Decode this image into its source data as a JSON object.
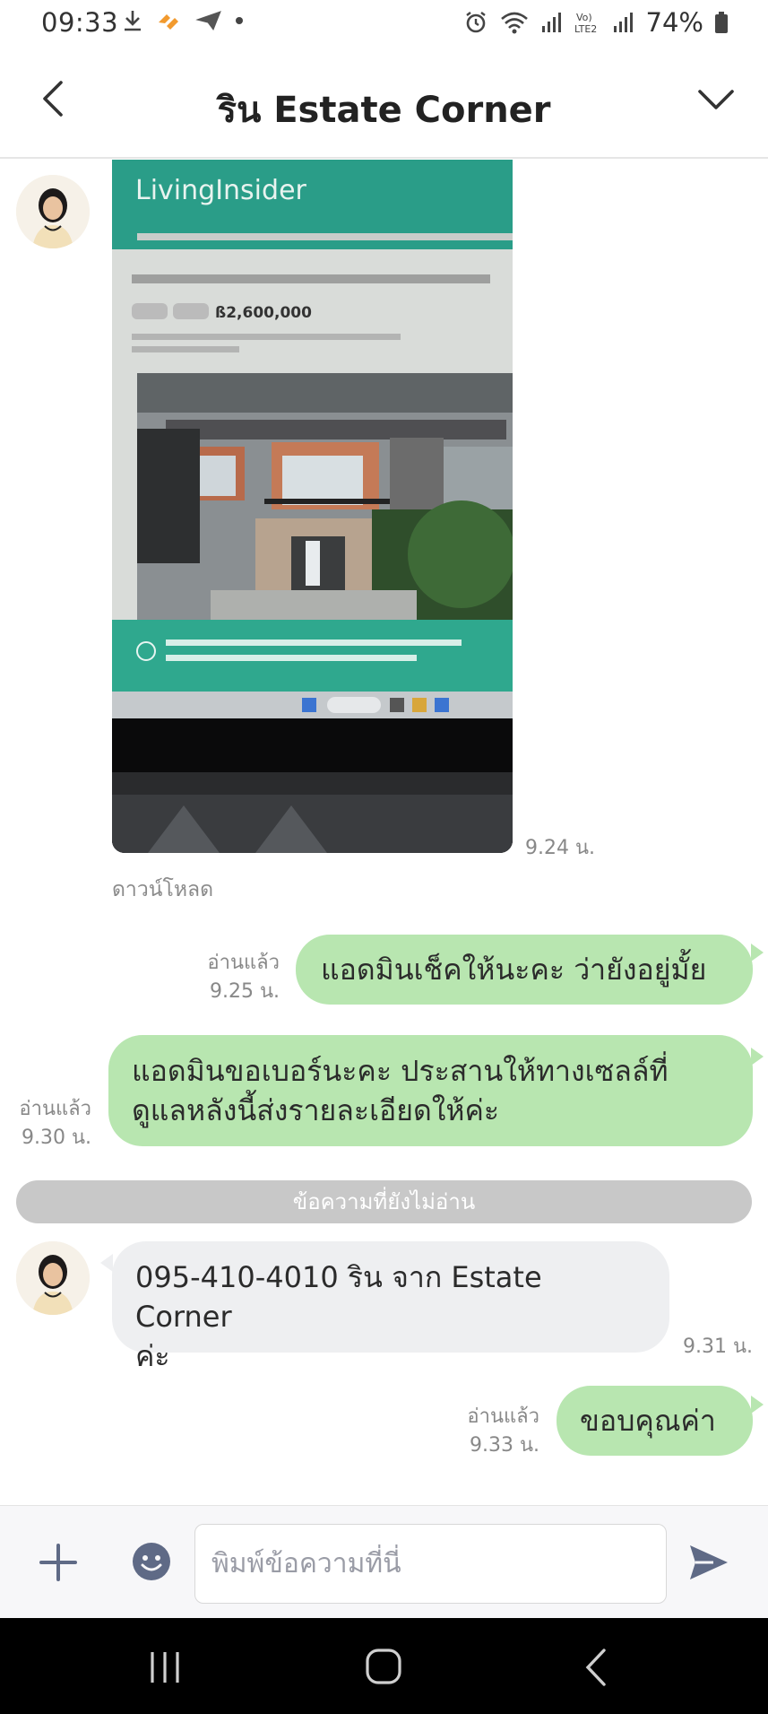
{
  "status_bar": {
    "time": "09:33",
    "battery_percent": "74%",
    "network_label": "VoLTE2"
  },
  "header": {
    "title": "ริน Estate Corner"
  },
  "messages": {
    "image_message": {
      "screenshot_brand": "LivingInsider",
      "screenshot_price": "ß2,600,000",
      "time": "9.24 น.",
      "download_label": "ดาวน์โหลด"
    },
    "out_1": {
      "text": "แอดมินเช็คให้นะคะ ว่ายังอยู่มั้ย",
      "read_label": "อ่านแล้ว",
      "time": "9.25 น."
    },
    "out_2": {
      "line1": "แอดมินขอเบอร์นะคะ ประสานให้ทางเซลล์ที่",
      "line2": "ดูแลหลังนี้ส่งรายละเอียดให้ค่ะ",
      "read_label": "อ่านแล้ว",
      "time": "9.30 น."
    },
    "unread_divider": "ข้อความที่ยังไม่อ่าน",
    "in_1": {
      "line1": "095-410-4010 ริน จาก Estate Corner",
      "line2": "ค่ะ",
      "time": "9.31 น."
    },
    "out_3": {
      "text": "ขอบคุณค่า",
      "read_label": "อ่านแล้ว",
      "time": "9.33 น."
    }
  },
  "input_bar": {
    "placeholder": "พิมพ์ข้อความที่นี่"
  },
  "colors": {
    "outgoing_bubble": "#b8e6b0",
    "incoming_bubble": "#eeeff1",
    "unread_divider": "#c8c8c8",
    "accent_icon": "#5f6a86"
  },
  "icons": {
    "back": "chevron-left-icon",
    "menu": "chevron-down-icon",
    "plus": "plus-icon",
    "emoji": "emoji-icon",
    "send": "send-icon"
  }
}
